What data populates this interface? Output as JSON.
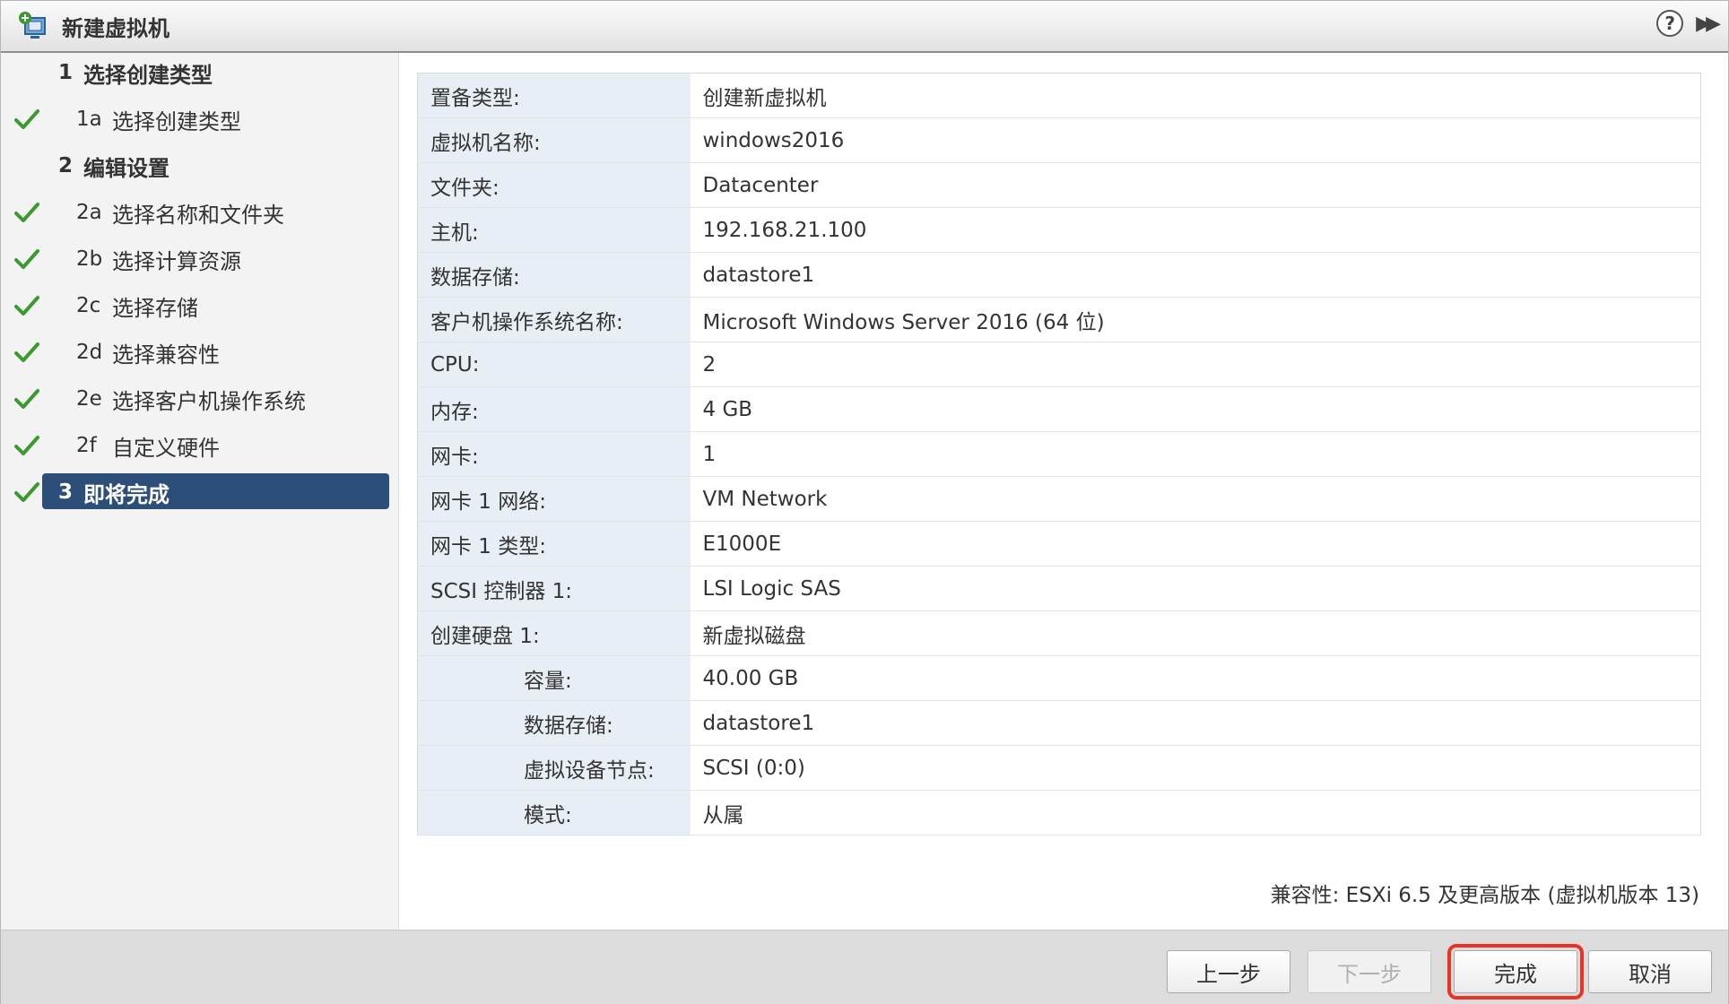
{
  "window": {
    "title": "新建虚拟机",
    "help_icon": "help-icon",
    "expand_icon": "expand-icon"
  },
  "sidebar": {
    "steps": [
      {
        "num": "1",
        "label": "选择创建类型",
        "checked": false
      },
      {
        "num": "1a",
        "label": "选择创建类型",
        "checked": true
      },
      {
        "num": "2",
        "label": "编辑设置",
        "checked": false
      },
      {
        "num": "2a",
        "label": "选择名称和文件夹",
        "checked": true
      },
      {
        "num": "2b",
        "label": "选择计算资源",
        "checked": true
      },
      {
        "num": "2c",
        "label": "选择存储",
        "checked": true
      },
      {
        "num": "2d",
        "label": "选择兼容性",
        "checked": true
      },
      {
        "num": "2e",
        "label": "选择客户机操作系统",
        "checked": true
      },
      {
        "num": "2f",
        "label": "自定义硬件",
        "checked": true
      },
      {
        "num": "3",
        "label": "即将完成",
        "checked": true
      }
    ]
  },
  "summary": {
    "rows": [
      {
        "key": "置备类型:",
        "value": "创建新虚拟机"
      },
      {
        "key": "虚拟机名称:",
        "value": "windows2016"
      },
      {
        "key": "文件夹:",
        "value": "Datacenter"
      },
      {
        "key": "主机:",
        "value": "192.168.21.100"
      },
      {
        "key": "数据存储:",
        "value": "datastore1"
      },
      {
        "key": "客户机操作系统名称:",
        "value": "Microsoft Windows Server 2016 (64 位)"
      },
      {
        "key": "CPU:",
        "value": "2"
      },
      {
        "key": "内存:",
        "value": "4 GB"
      },
      {
        "key": "网卡:",
        "value": "1"
      },
      {
        "key": "网卡 1 网络:",
        "value": "VM Network"
      },
      {
        "key": "网卡 1 类型:",
        "value": "E1000E"
      },
      {
        "key": "SCSI 控制器 1:",
        "value": "LSI Logic SAS"
      },
      {
        "key": "创建硬盘 1:",
        "value": "新虚拟磁盘"
      },
      {
        "key": "容量:",
        "value": "40.00 GB"
      },
      {
        "key": "数据存储:",
        "value": "datastore1"
      },
      {
        "key": "虚拟设备节点:",
        "value": "SCSI (0:0)"
      },
      {
        "key": "模式:",
        "value": "从属"
      }
    ]
  },
  "compat_text": "兼容性: ESXi 6.5 及更高版本 (虚拟机版本 13)",
  "footer": {
    "back_label": "上一步",
    "next_label": "下一步",
    "finish_label": "完成",
    "cancel_label": "取消"
  },
  "colors": {
    "active_step": "#2c4e78",
    "check": "#3a9a2e",
    "highlight": "#ea3323"
  }
}
